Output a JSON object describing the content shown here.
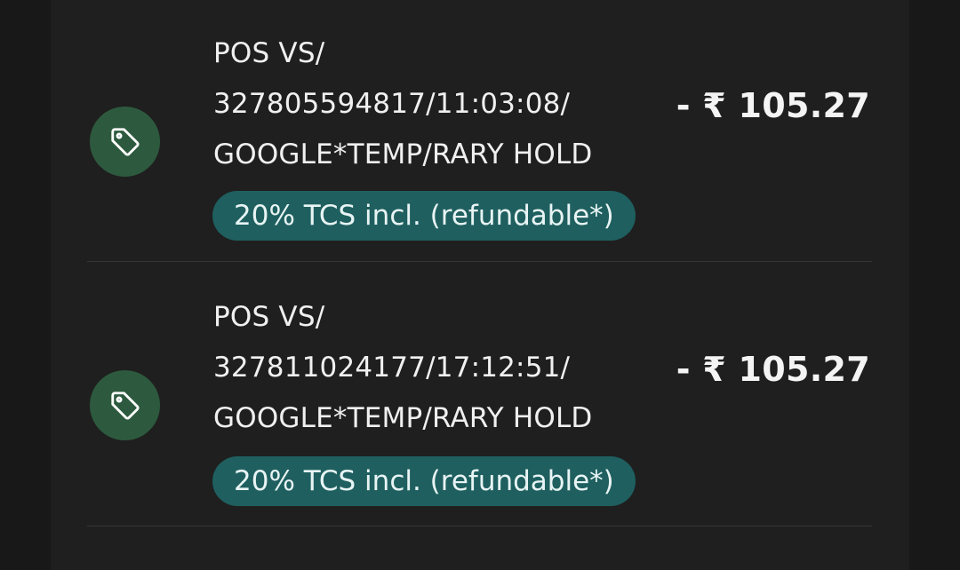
{
  "colors": {
    "background": "#181818",
    "panel": "#1f1f1f",
    "icon_bg": "#2d5a3e",
    "badge_bg": "#1f5f5f",
    "text": "#f0f0f0",
    "divider": "#353535"
  },
  "transactions": [
    {
      "icon": "tag-icon",
      "description": "POS VS/\n327805594817/11:03:08/\nGOOGLE*TEMP/RARY HOLD",
      "tcs_label": "20% TCS incl. (refundable*)",
      "amount": "- ₹ 105.27"
    },
    {
      "icon": "tag-icon",
      "description": "POS VS/\n327811024177/17:12:51/\nGOOGLE*TEMP/RARY HOLD",
      "tcs_label": "20% TCS incl. (refundable*)",
      "amount": "- ₹ 105.27"
    }
  ]
}
